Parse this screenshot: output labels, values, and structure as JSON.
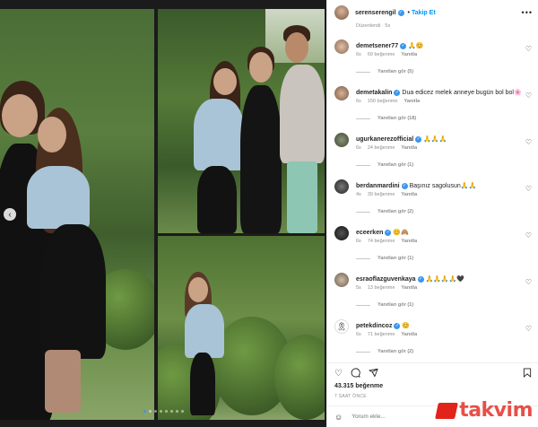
{
  "post": {
    "username": "serenserengil",
    "follow_label": "Takip Et",
    "more_icon": "more-horizontal-icon",
    "edited_label": "Düzenlendi · 5s"
  },
  "comments": [
    {
      "user": "demetsener77",
      "verified": true,
      "text": " 🙏😊",
      "time": "6s",
      "likes": "69 beğenme",
      "reply": "Yanıtla",
      "view_replies": "Yanıtları gör (5)",
      "avatar_color": "#c49a7e"
    },
    {
      "user": "demetakalin",
      "verified": true,
      "text": " Dua edicez melek anneye bugün bol bol🌸",
      "time": "6s",
      "likes": "150 beğenme",
      "reply": "Yanıtla",
      "view_replies": "Yanıtları gör (18)",
      "avatar_color": "#b88c73"
    },
    {
      "user": "ugurkanerezofficial",
      "verified": true,
      "text": " 🙏🙏🙏",
      "time": "6s",
      "likes": "24 beğenme",
      "reply": "Yanıtla",
      "view_replies": "Yanıtları gör (1)",
      "avatar_color": "#5e6b52"
    },
    {
      "user": "berdanmardini",
      "verified": true,
      "text": " Başınız sagolusun🙏🙏",
      "time": "4s",
      "likes": "39 beğenme",
      "reply": "Yanıtla",
      "view_replies": "Yanıtları gör (2)",
      "avatar_color": "#3d3d3d"
    },
    {
      "user": "eceerken",
      "verified": true,
      "text": " 😊🙈",
      "time": "6s",
      "likes": "74 beğenme",
      "reply": "Yanıtla",
      "view_replies": "Yanıtları gör (1)",
      "avatar_color": "#2b2b2b"
    },
    {
      "user": "esraoflazguvenkaya",
      "verified": true,
      "text": " 🙏🙏🙏🙏🖤",
      "time": "5s",
      "likes": "13 beğenme",
      "reply": "Yanıtla",
      "view_replies": "Yanıtları gör (1)",
      "avatar_color": "#9a8a7a"
    },
    {
      "user": "petekdincoz",
      "verified": true,
      "text": " 😊",
      "time": "6s",
      "likes": "71 beğenme",
      "reply": "Yanıtla",
      "view_replies": "Yanıtları gör (2)",
      "avatar_color": "#ffffff"
    }
  ],
  "actions": {
    "like_icon": "heart-icon",
    "comment_icon": "comment-icon",
    "share_icon": "share-icon",
    "save_icon": "bookmark-icon"
  },
  "likes_count": "43.315 beğenme",
  "posted_ago": "7 SAAT ÖNCE",
  "comment_input": {
    "placeholder": "Yorum ekle..."
  },
  "watermark": "takvim"
}
